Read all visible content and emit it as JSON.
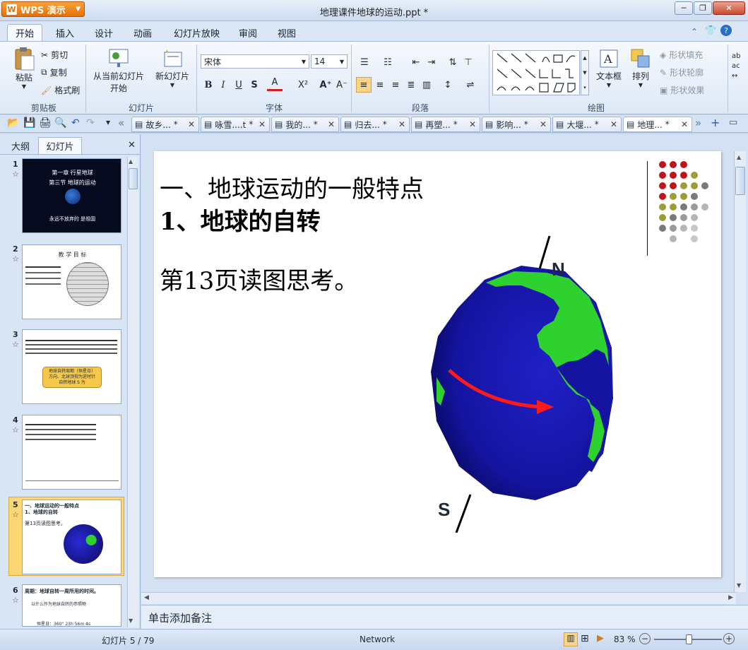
{
  "window": {
    "app_label": "WPS 演示",
    "title": "地理课件地球的运动.ppt *",
    "controls": {
      "minimize": "─",
      "restore": "❐",
      "close": "✕"
    }
  },
  "ribbon_tabs": [
    {
      "label": "开始",
      "active": true
    },
    {
      "label": "插入"
    },
    {
      "label": "设计"
    },
    {
      "label": "动画"
    },
    {
      "label": "幻灯片放映"
    },
    {
      "label": "审阅"
    },
    {
      "label": "视图"
    }
  ],
  "ribbon": {
    "clipboard": {
      "paste": "粘贴",
      "cut": "剪切",
      "copy": "复制",
      "format_painter": "格式刷",
      "group": "剪贴板"
    },
    "slides": {
      "from_current": "从当前幻灯片",
      "from_current_2": "开始",
      "new_slide": "新幻灯片",
      "group": "幻灯片"
    },
    "font": {
      "family": "宋体",
      "size": "14",
      "bold": "B",
      "italic": "I",
      "underline": "U",
      "shadow": "S",
      "color": "A",
      "superscript": "X²",
      "grow": "A⁺",
      "shrink": "A⁻",
      "group": "字体"
    },
    "paragraph": {
      "group": "段落"
    },
    "drawing": {
      "textbox": "文本框",
      "arrange": "排列",
      "shape_fill": "形状填充",
      "shape_outline": "形状轮廓",
      "shape_effect": "形状效果",
      "group": "绘图"
    }
  },
  "doc_tabs": [
    {
      "label": "故乡..."
    },
    {
      "label": "咏雪....t"
    },
    {
      "label": "我的..."
    },
    {
      "label": "归去..."
    },
    {
      "label": "再塑..."
    },
    {
      "label": "影响..."
    },
    {
      "label": "大堰..."
    },
    {
      "label": "地理...",
      "active": true
    }
  ],
  "panel": {
    "tab_outline": "大纲",
    "tab_slides": "幻灯片",
    "close": "✕"
  },
  "thumbnails": [
    {
      "num": "1",
      "lines": [
        "第一章 行星地球",
        "第三节 地球的运动"
      ],
      "footer": "永远不放弃的 是祖国"
    },
    {
      "num": "2",
      "heading": "教 学 目 标"
    },
    {
      "num": "3",
      "callout": [
        "地球自转周期（恒星日）",
        "方向、北球顶视为逆时针",
        "自转地球 S 为"
      ]
    },
    {
      "num": "4"
    },
    {
      "num": "5",
      "lines": [
        "一、地球运动的一般特点",
        "1、地球的自转",
        "第13页读图思考。"
      ],
      "selected": true
    },
    {
      "num": "6",
      "lines": [
        "周期：地球自转一周所用的时间。",
        "以什么作为地球自转的参照物",
        "恒星日：360°     23h 56m 4s"
      ]
    }
  ],
  "slide": {
    "title_line1": "一、地球运动的一般特点",
    "title_line2": "1、地球的自转",
    "body": "第13页读图思考。",
    "north": "N",
    "south": "S"
  },
  "notes_placeholder": "单击添加备注",
  "status": {
    "slide_counter": "幻灯片 5 / 79",
    "theme": "Network",
    "zoom": "83 %",
    "zoom_fraction": 0.52
  },
  "colors": {
    "accent_orange": "#e46f07",
    "ocean": "#1a1aa0",
    "land": "#2fd12f",
    "arrow": "#ff1a1a"
  }
}
